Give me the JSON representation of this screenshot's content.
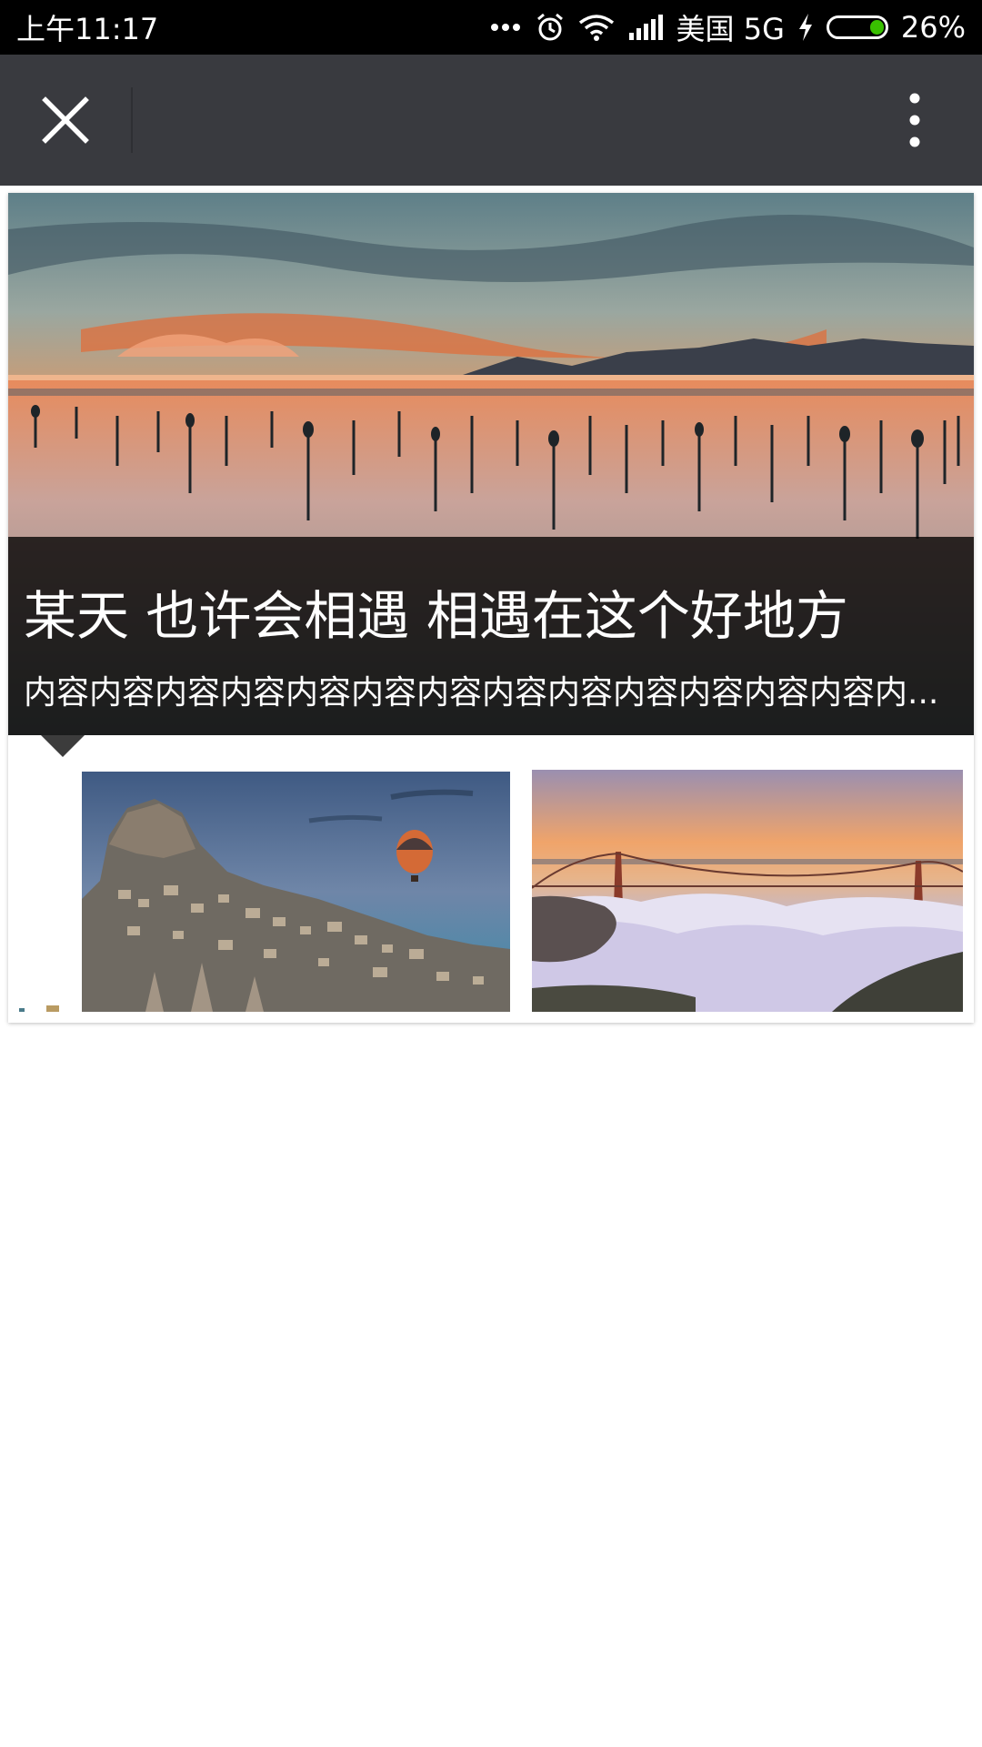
{
  "status_bar": {
    "time": "上午11:17",
    "carrier": "美国 5G",
    "battery_percent": "26%",
    "battery_level": 0.26,
    "icons": [
      "more-dots-icon",
      "alarm-icon",
      "wifi-icon",
      "signal-icon",
      "charging-icon",
      "battery-icon"
    ]
  },
  "top_bar": {
    "close_icon": "close-icon",
    "more_icon": "more-vertical-icon"
  },
  "article_card": {
    "title": "某天 也许会相遇 相遇在这个好地方",
    "description": "内容内容内容内容内容内容内容内容内容内容内容内容内容内容内容内容",
    "hero_image": "sunset-lake-image",
    "thumbnails": [
      {
        "image": "cappadocia-balloon-image"
      },
      {
        "image": "golden-gate-fog-image"
      }
    ]
  },
  "colors": {
    "status_bar_bg": "#000000",
    "top_bar_bg": "#393a3f",
    "battery_fill": "#39c000",
    "caption_overlay": "#000000"
  }
}
